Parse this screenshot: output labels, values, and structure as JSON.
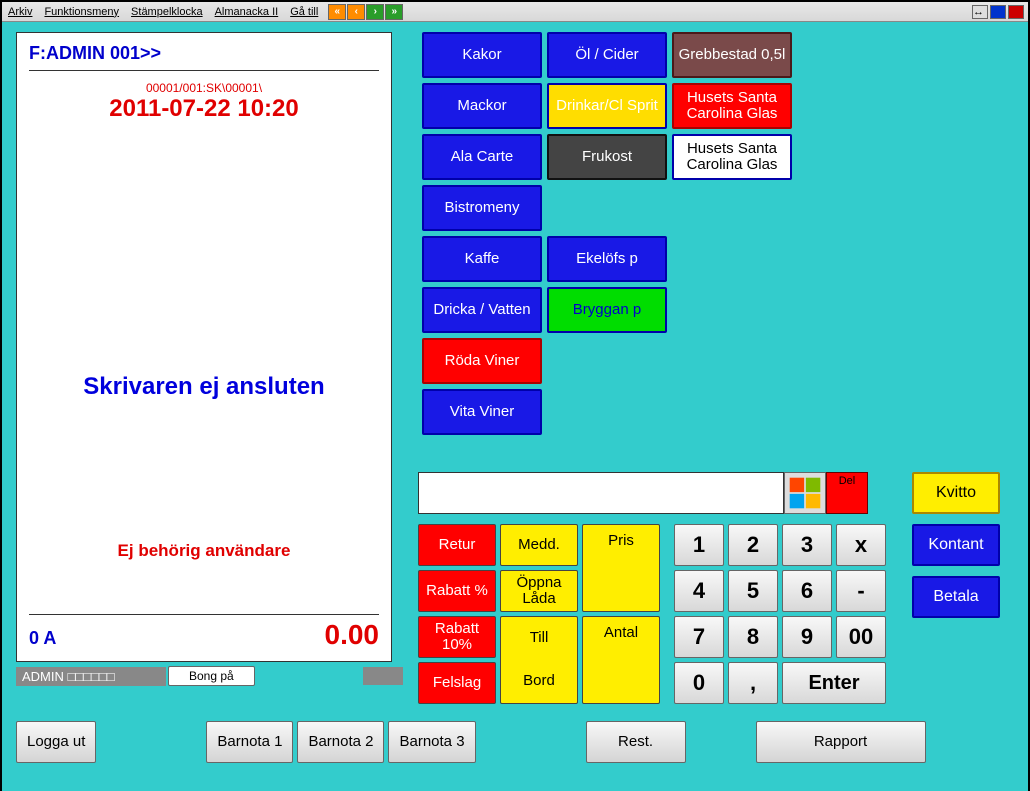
{
  "menubar": {
    "items": [
      "Arkiv",
      "Funktionsmeny",
      "Stämpelklocka",
      "Almanacka II",
      "Gå till"
    ]
  },
  "receipt": {
    "title": "F:ADMIN  001>>",
    "small": "00001/001:SK\\00001\\",
    "datetime": "2011-07-22 10:20",
    "printer_msg": "Skrivaren ej ansluten",
    "auth_msg": "Ej behörig användare",
    "footer_left": "0 A",
    "footer_right": "0.00"
  },
  "status": {
    "admin": "ADMIN  □□□□□□",
    "bong": "Bong på"
  },
  "categories": [
    {
      "label": "Kakor",
      "cls": "blue"
    },
    {
      "label": "Öl / Cider",
      "cls": "blue"
    },
    {
      "label": "Grebbestad 0,5l",
      "cls": "brown"
    },
    {
      "label": "Mackor",
      "cls": "blue"
    },
    {
      "label": "Drinkar/Cl Sprit",
      "cls": "yellow"
    },
    {
      "label": "Husets Santa Carolina Glas",
      "cls": "red"
    },
    {
      "label": "Ala Carte",
      "cls": "blue"
    },
    {
      "label": "Frukost",
      "cls": "grey"
    },
    {
      "label": "Husets Santa Carolina Glas",
      "cls": "white"
    },
    {
      "label": "Bistromeny",
      "cls": "blue"
    },
    {
      "label": "",
      "cls": "empty"
    },
    {
      "label": "",
      "cls": "empty"
    },
    {
      "label": "Kaffe",
      "cls": "blue"
    },
    {
      "label": "Ekelöfs p",
      "cls": "blue"
    },
    {
      "label": "",
      "cls": "empty"
    },
    {
      "label": "Dricka / Vatten",
      "cls": "blue"
    },
    {
      "label": "Bryggan p",
      "cls": "green"
    },
    {
      "label": "",
      "cls": "empty"
    },
    {
      "label": "Röda Viner",
      "cls": "red"
    },
    {
      "label": "",
      "cls": "empty"
    },
    {
      "label": "",
      "cls": "empty"
    },
    {
      "label": "Vita Viner",
      "cls": "blue"
    },
    {
      "label": "",
      "cls": "empty"
    },
    {
      "label": "",
      "cls": "empty"
    }
  ],
  "del_label": "Del",
  "mid": {
    "retur": "Retur",
    "medd": "Medd.",
    "pris": "Pris",
    "rabatt_pct": "Rabatt %",
    "oppna": "Öppna Låda",
    "rabatt_10": "Rabatt 10%",
    "till": "Till",
    "bord": "Bord",
    "antal": "Antal",
    "felslag": "Felslag"
  },
  "keypad": [
    "1",
    "2",
    "3",
    "x",
    "4",
    "5",
    "6",
    "-",
    "7",
    "8",
    "9",
    "00",
    "0",
    ",",
    "Enter"
  ],
  "right": {
    "kvitto": "Kvitto",
    "kontant": "Kontant",
    "betala": "Betala"
  },
  "bottom": {
    "logga": "Logga ut",
    "b1": "Barnota 1",
    "b2": "Barnota 2",
    "b3": "Barnota 3",
    "rest": "Rest.",
    "rapport": "Rapport"
  }
}
